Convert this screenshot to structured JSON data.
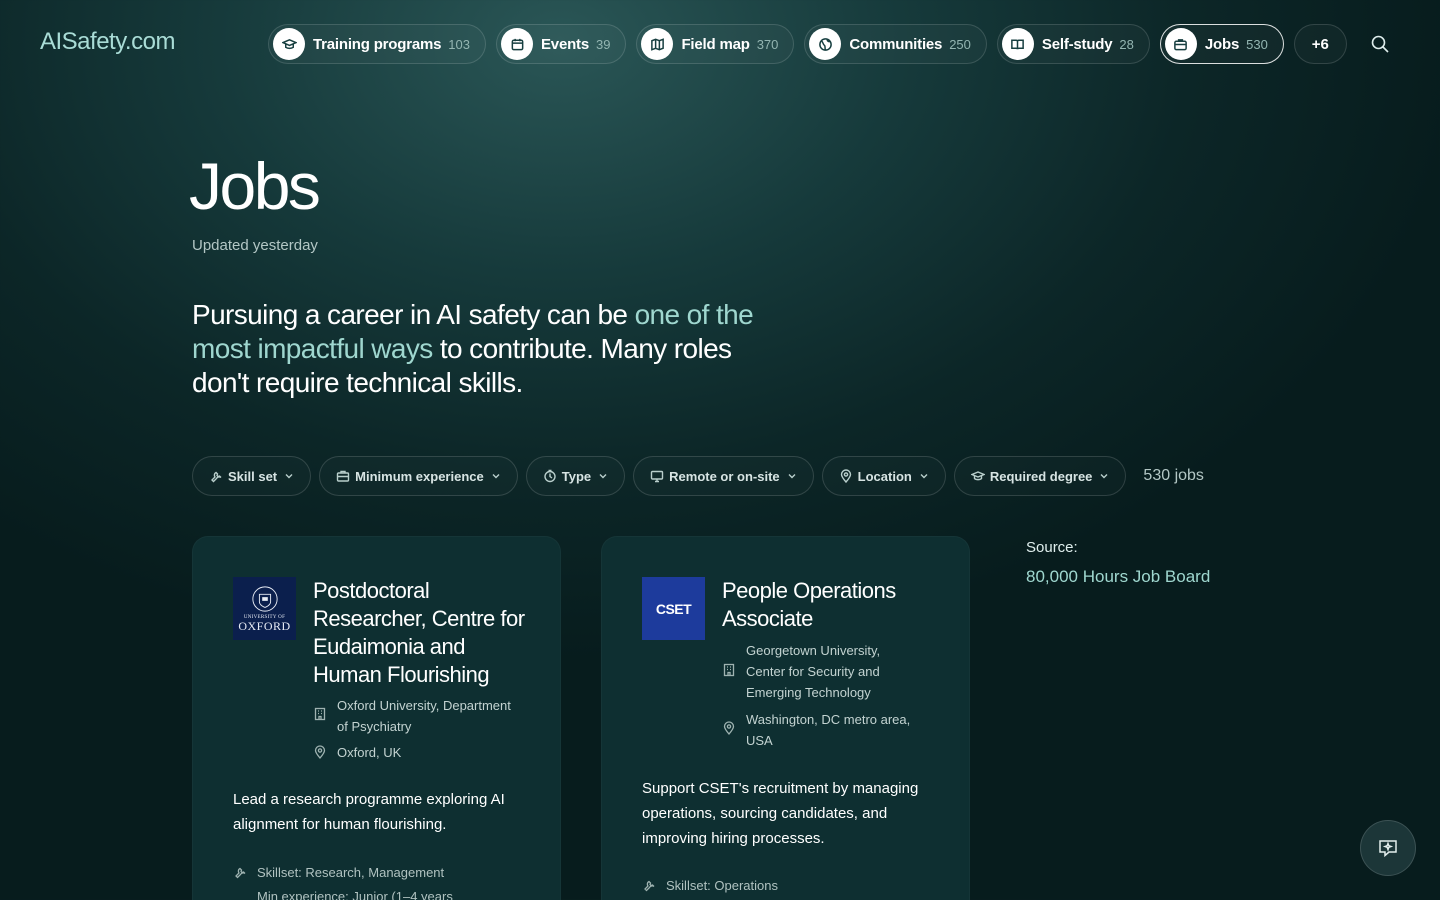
{
  "site": {
    "logo": "AISafety.com"
  },
  "nav": {
    "items": [
      {
        "label": "Training programs",
        "count": "103",
        "icon": "graduation-cap-icon"
      },
      {
        "label": "Events",
        "count": "39",
        "icon": "calendar-icon"
      },
      {
        "label": "Field map",
        "count": "370",
        "icon": "map-icon"
      },
      {
        "label": "Communities",
        "count": "250",
        "icon": "globe-icon"
      },
      {
        "label": "Self-study",
        "count": "28",
        "icon": "book-icon"
      },
      {
        "label": "Jobs",
        "count": "530",
        "icon": "briefcase-icon",
        "active": true
      }
    ],
    "more_label": "+6"
  },
  "page": {
    "title": "Jobs",
    "updated": "Updated yesterday",
    "intro_before": "Pursuing a career in AI safety can be ",
    "intro_highlight": "one of the most impactful ways",
    "intro_after": " to contribute. Many roles don't require technical skills."
  },
  "filters": {
    "skill_set": "Skill set",
    "min_experience": "Minimum experience",
    "type": "Type",
    "remote": "Remote or on-site",
    "location": "Location",
    "degree": "Required degree",
    "job_count": "530 jobs"
  },
  "jobs": [
    {
      "title": "Postdoctoral Researcher, Centre for Eudaimonia and Human Flourishing",
      "org": "Oxford University, Department of Psychiatry",
      "location": "Oxford, UK",
      "description": "Lead a research programme exploring AI alignment for human flourishing.",
      "skillset": "Skillset: Research, Management",
      "min_experience": "Min experience: Junior (1–4 years",
      "logo_small": "UNIVERSITY OF",
      "logo_big": "OXFORD"
    },
    {
      "title": "People Operations Associate",
      "org": "Georgetown University, Center for Security and Emerging Technology",
      "location": "Washington, DC metro area, USA",
      "description": "Support CSET's recruitment by managing operations, sourcing candidates, and improving hiring processes.",
      "skillset": "Skillset: Operations",
      "logo_text": "CSET"
    }
  ],
  "source": {
    "label": "Source:",
    "value": "80,000 Hours Job Board"
  },
  "colors": {
    "accent": "#9fd7cf",
    "card": "#0e2f31",
    "oxford_blue": "#0b1f4d",
    "cset_blue": "#1d3b9c"
  }
}
